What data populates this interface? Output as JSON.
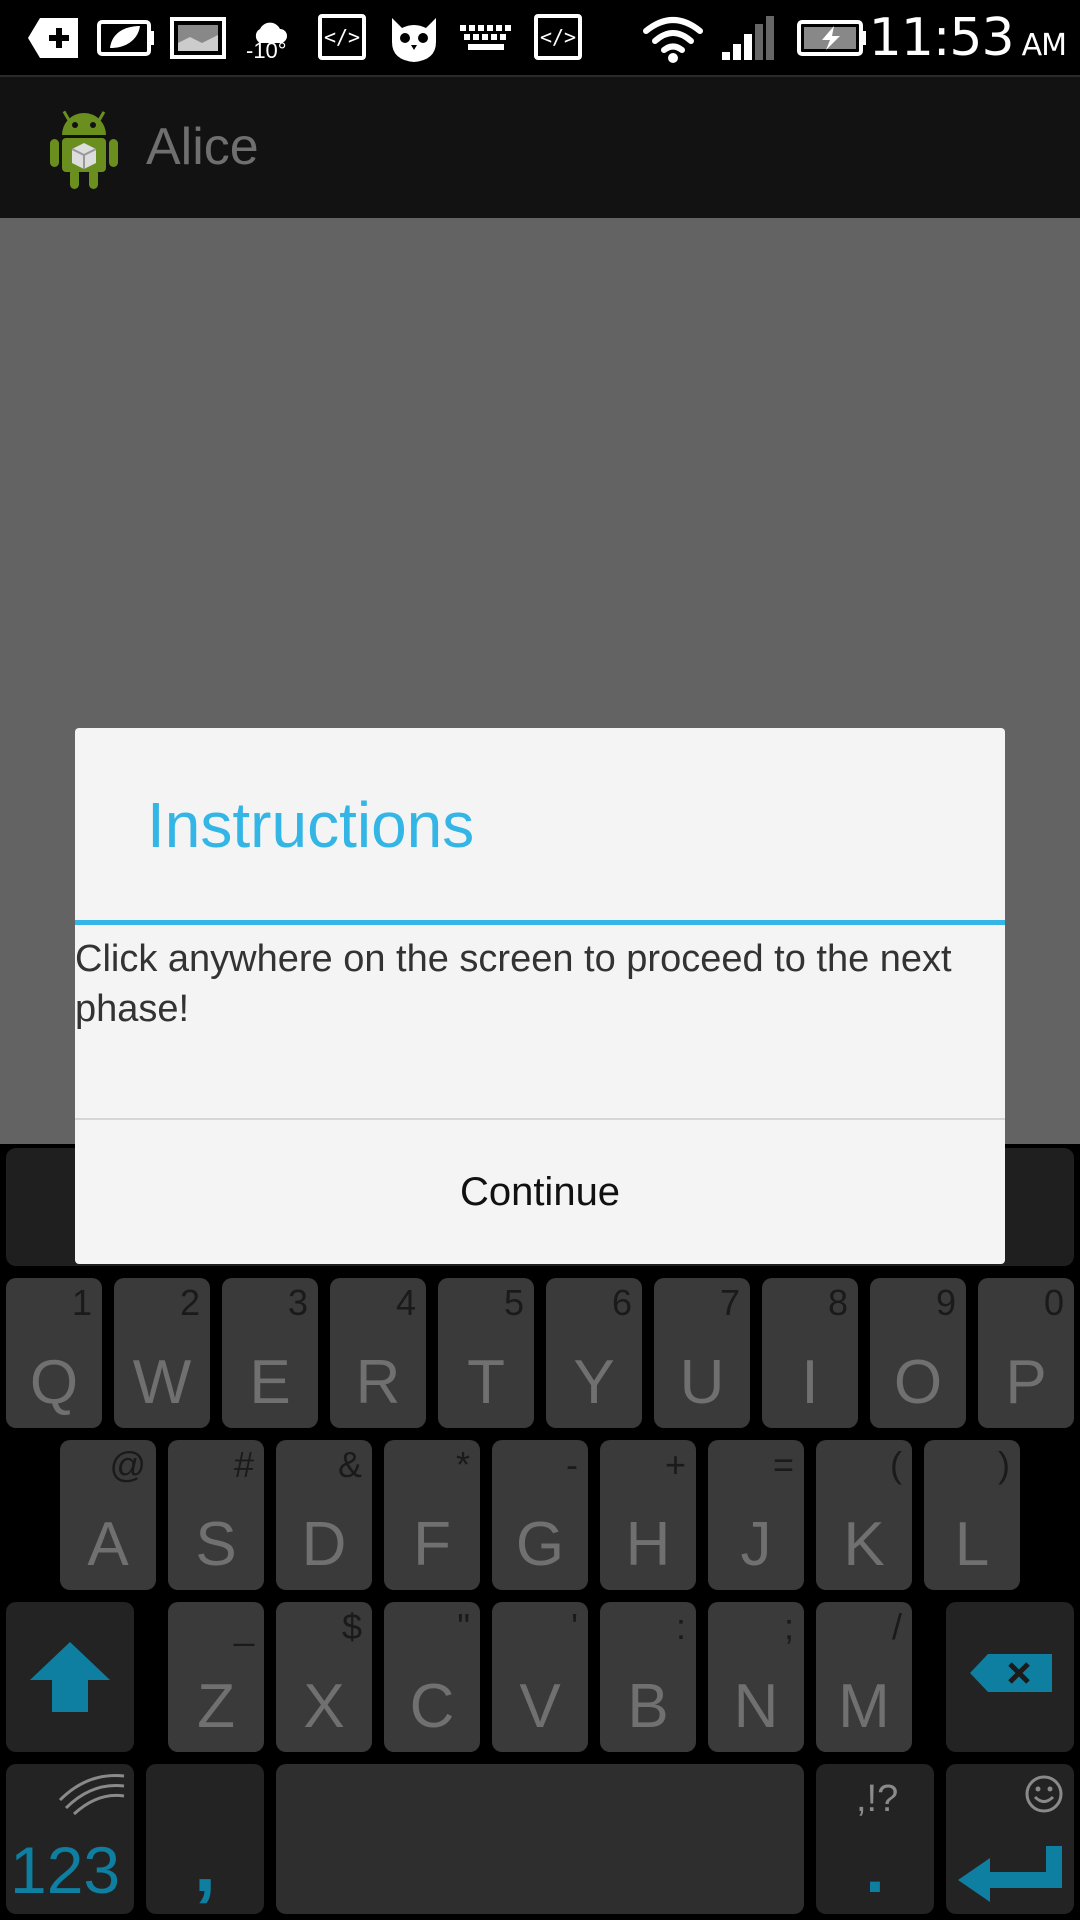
{
  "status_bar": {
    "icons": [
      "plus-icon",
      "leaf-battery-icon",
      "image-icon",
      "weather-icon",
      "code-icon",
      "owl-icon",
      "keyboard-icon",
      "code-icon",
      "wifi-icon",
      "signal-icon",
      "battery-charging-icon"
    ],
    "temperature": "-10°",
    "time": "11:53",
    "ampm": "AM"
  },
  "action_bar": {
    "app_icon": "android-icon",
    "title": "Alice"
  },
  "dialog": {
    "title": "Instructions",
    "message": "Click anywhere on the screen to proceed to the next phase!",
    "button_label": "Continue"
  },
  "keyboard": {
    "row1": [
      {
        "key": "Q",
        "sub": "1"
      },
      {
        "key": "W",
        "sub": "2"
      },
      {
        "key": "E",
        "sub": "3"
      },
      {
        "key": "R",
        "sub": "4"
      },
      {
        "key": "T",
        "sub": "5"
      },
      {
        "key": "Y",
        "sub": "6"
      },
      {
        "key": "U",
        "sub": "7"
      },
      {
        "key": "I",
        "sub": "8"
      },
      {
        "key": "O",
        "sub": "9"
      },
      {
        "key": "P",
        "sub": "0"
      }
    ],
    "row2": [
      {
        "key": "A",
        "sub": "@"
      },
      {
        "key": "S",
        "sub": "#"
      },
      {
        "key": "D",
        "sub": "&"
      },
      {
        "key": "F",
        "sub": "*"
      },
      {
        "key": "G",
        "sub": "-"
      },
      {
        "key": "H",
        "sub": "+"
      },
      {
        "key": "J",
        "sub": "="
      },
      {
        "key": "K",
        "sub": "("
      },
      {
        "key": "L",
        "sub": ")"
      }
    ],
    "row3": [
      {
        "key": "Z",
        "sub": "_"
      },
      {
        "key": "X",
        "sub": "$"
      },
      {
        "key": "C",
        "sub": "\""
      },
      {
        "key": "V",
        "sub": "'"
      },
      {
        "key": "B",
        "sub": ":"
      },
      {
        "key": "N",
        "sub": ";"
      },
      {
        "key": "M",
        "sub": "/"
      }
    ],
    "shift_icon": "shift-arrow-icon",
    "backspace_icon": "backspace-icon",
    "numbers_label": "123",
    "comma_label": ",",
    "period_label": ".",
    "period_sub": ",!?",
    "emoji_icon": "smiley-icon",
    "enter_icon": "enter-icon",
    "accent_color": "#0e7fa0"
  }
}
